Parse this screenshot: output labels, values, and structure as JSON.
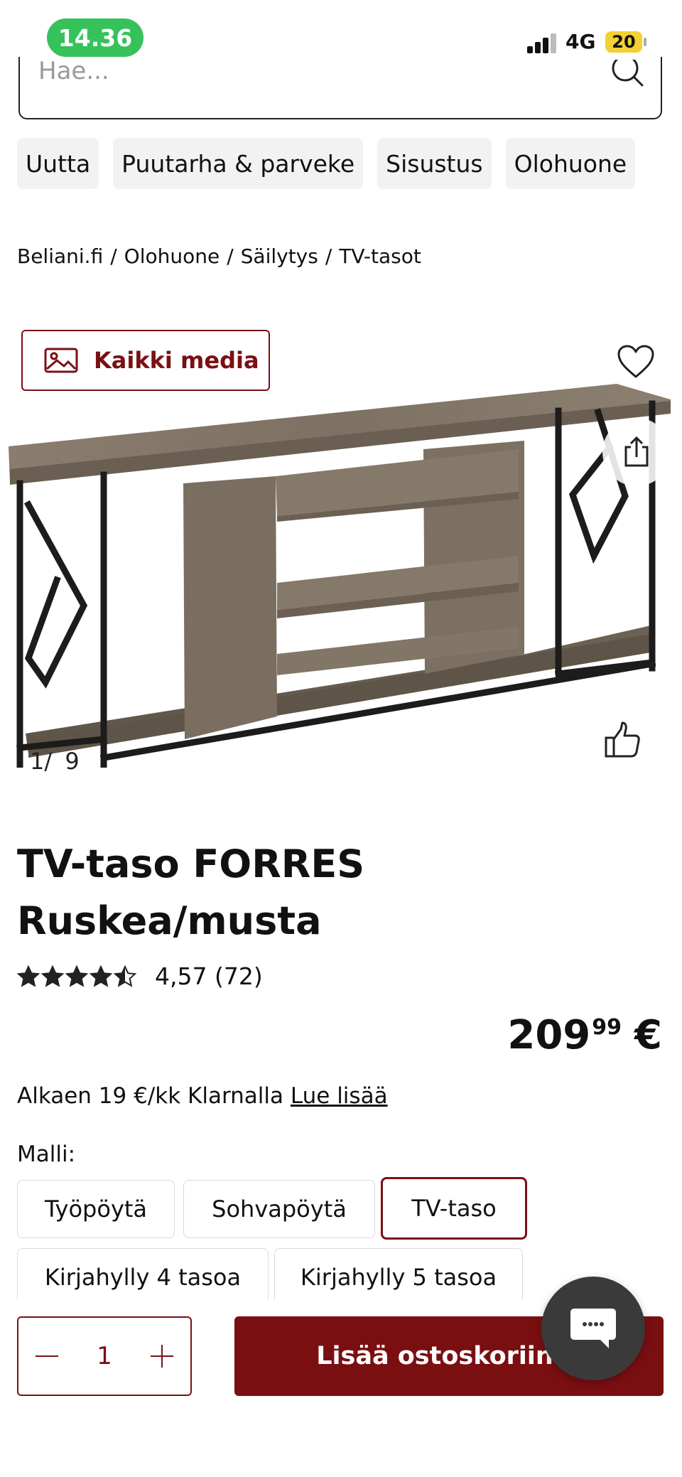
{
  "status_bar": {
    "time": "14.36",
    "network": "4G",
    "battery": "20"
  },
  "search": {
    "placeholder": "Hae..."
  },
  "categories": [
    "Uutta",
    "Puutarha & parveke",
    "Sisustus",
    "Olohuone"
  ],
  "breadcrumb": [
    "Beliani.fi",
    "Olohuone",
    "Säilytys",
    "TV-tasot"
  ],
  "gallery": {
    "all_media_label": "Kaikki media",
    "counter": "1/ 9",
    "current": 1,
    "total": 9
  },
  "product": {
    "title_line1": "TV-taso FORRES",
    "title_line2": "Ruskea/musta",
    "rating_value": 4.57,
    "rating_text": "4,57 (72)",
    "price_integer": "209",
    "price_decimals": "99",
    "currency": "€",
    "klarna_text": "Alkaen 19 €/kk Klarnalla",
    "klarna_link": "Lue lisää"
  },
  "model": {
    "label": "Malli:",
    "options": [
      "Työpöytä",
      "Sohvapöytä",
      "TV-taso",
      "Kirjahylly 4 tasoa",
      "Kirjahylly 5 tasoa"
    ],
    "selected": "TV-taso"
  },
  "cart": {
    "quantity": "1",
    "add_label": "Lisää ostoskoriin"
  },
  "colors": {
    "accent": "#7a1014",
    "status_green": "#35c25a",
    "battery_yellow": "#f3d034",
    "chip_bg": "#f2f2f2"
  },
  "icons": [
    "search-icon",
    "image-icon",
    "heart-icon",
    "share-icon",
    "thumbs-up-icon",
    "star-icon",
    "minus-icon",
    "plus-icon",
    "chat-icon"
  ]
}
